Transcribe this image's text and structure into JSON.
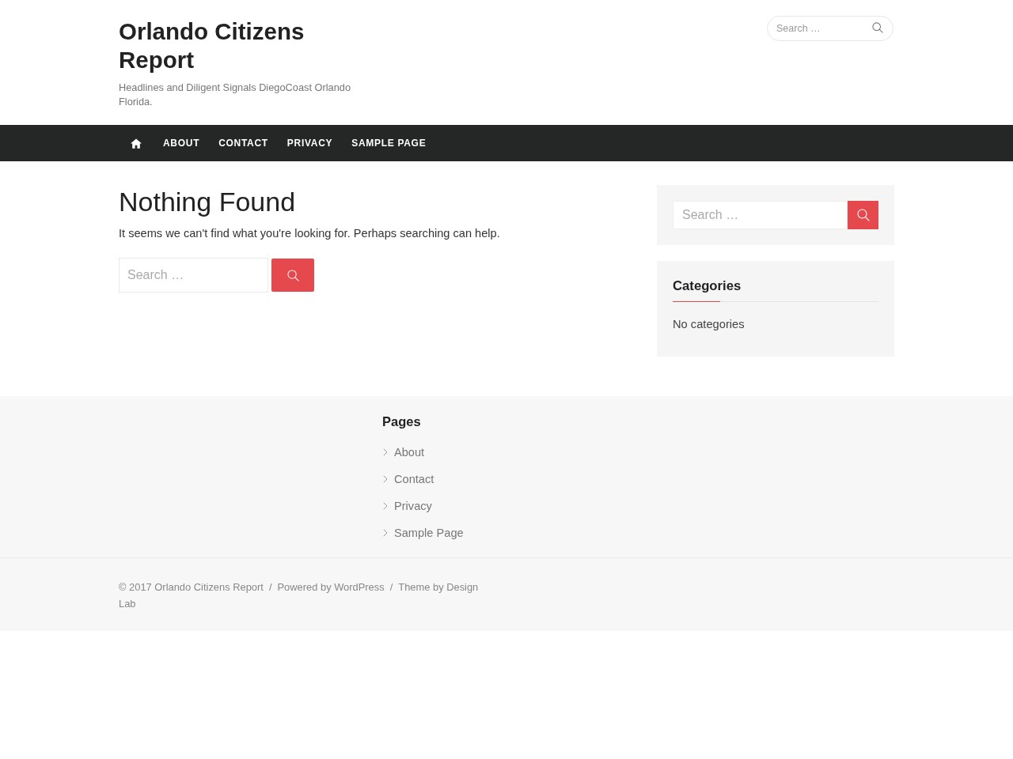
{
  "header": {
    "site_title": "Orlando Citizens Report",
    "tagline": "Headlines and Diligent Signals DiegoCoast Orlando Florida.",
    "search": {
      "placeholder": "Search …"
    }
  },
  "nav": {
    "items": [
      {
        "kind": "home"
      },
      {
        "kind": "link",
        "label": "ABOUT"
      },
      {
        "kind": "link",
        "label": "CONTACT"
      },
      {
        "kind": "link",
        "label": "PRIVACY"
      },
      {
        "kind": "link",
        "label": "SAMPLE PAGE"
      }
    ]
  },
  "main": {
    "title": "Nothing Found",
    "message": "It seems we can't find what you're looking for. Perhaps searching can help.",
    "search": {
      "placeholder": "Search …"
    }
  },
  "sidebar": {
    "widgets": [
      {
        "kind": "search",
        "placeholder": "Search …"
      },
      {
        "kind": "list",
        "title": "Categories",
        "empty_text": "No categories"
      }
    ]
  },
  "footer_widgets": [
    {
      "title": "Pages",
      "items": [
        "About",
        "Contact",
        "Privacy",
        "Sample Page"
      ]
    }
  ],
  "footer": {
    "credits": [
      "© 2017 Orlando Citizens Report",
      "Powered by WordPress",
      "Theme by Design Lab"
    ],
    "separator": "/"
  }
}
